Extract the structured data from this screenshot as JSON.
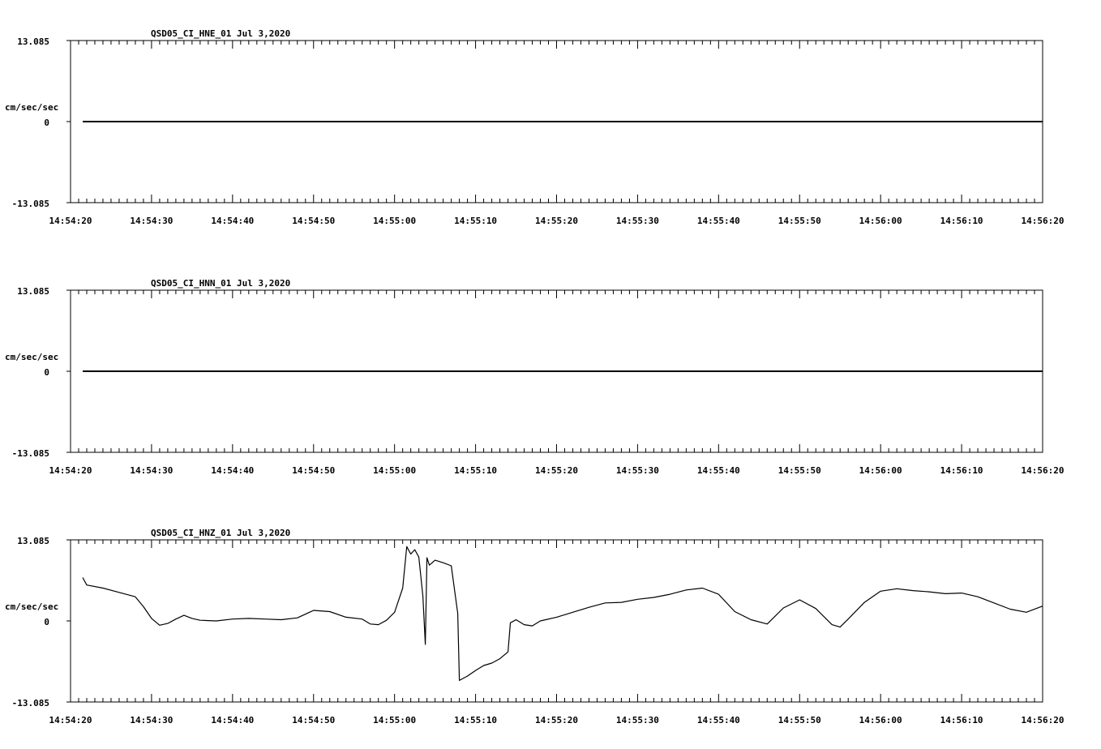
{
  "chart_data": [
    {
      "type": "line",
      "title": "QSD05_CI_HNE_01  Jul 3,2020",
      "ylabel": "cm/sec/sec",
      "ylim": [
        -13.085,
        13.085
      ],
      "ytick_labels": [
        "13.085",
        "0",
        "-13.085"
      ],
      "xlim": [
        "14:54:20",
        "14:56:20"
      ],
      "xtick_labels": [
        "14:54:20",
        "14:54:30",
        "14:54:40",
        "14:54:50",
        "14:55:00",
        "14:55:10",
        "14:55:20",
        "14:55:30",
        "14:55:40",
        "14:55:50",
        "14:56:00",
        "14:56:10",
        "14:56:20"
      ],
      "series": [
        {
          "x": [
            "14:54:21.5",
            "14:56:20"
          ],
          "y": [
            0,
            0
          ]
        }
      ]
    },
    {
      "type": "line",
      "title": "QSD05_CI_HNN_01  Jul 3,2020",
      "ylabel": "cm/sec/sec",
      "ylim": [
        -13.085,
        13.085
      ],
      "ytick_labels": [
        "13.085",
        "0",
        "-13.085"
      ],
      "xlim": [
        "14:54:20",
        "14:56:20"
      ],
      "xtick_labels": [
        "14:54:20",
        "14:54:30",
        "14:54:40",
        "14:54:50",
        "14:55:00",
        "14:55:10",
        "14:55:20",
        "14:55:30",
        "14:55:40",
        "14:55:50",
        "14:56:00",
        "14:56:10",
        "14:56:20"
      ],
      "series": [
        {
          "x": [
            "14:54:21.5",
            "14:56:20"
          ],
          "y": [
            0,
            0
          ]
        }
      ]
    },
    {
      "type": "line",
      "title": "QSD05_CI_HNZ_01  Jul 3,2020",
      "ylabel": "cm/sec/sec",
      "ylim": [
        -13.085,
        13.085
      ],
      "ytick_labels": [
        "13.085",
        "0",
        "-13.085"
      ],
      "xlim": [
        "14:54:20",
        "14:56:20"
      ],
      "xtick_labels": [
        "14:54:20",
        "14:54:30",
        "14:54:40",
        "14:54:50",
        "14:55:00",
        "14:55:10",
        "14:55:20",
        "14:55:30",
        "14:55:40",
        "14:55:50",
        "14:56:00",
        "14:56:10",
        "14:56:20"
      ],
      "series": [
        {
          "x": [
            "14:54:21.5",
            "14:54:22",
            "14:54:24",
            "14:54:26",
            "14:54:28",
            "14:54:29",
            "14:54:30",
            "14:54:31",
            "14:54:32",
            "14:54:33",
            "14:54:34",
            "14:54:35",
            "14:54:36",
            "14:54:38",
            "14:54:40",
            "14:54:42",
            "14:54:44",
            "14:54:46",
            "14:54:48",
            "14:54:50",
            "14:54:52",
            "14:54:54",
            "14:54:56",
            "14:54:57",
            "14:54:58",
            "14:54:59",
            "14:55:00",
            "14:55:01",
            "14:55:01.5",
            "14:55:02",
            "14:55:02.5",
            "14:55:03",
            "14:55:03.5",
            "14:55:03.8",
            "14:55:04",
            "14:55:04.3",
            "14:55:05",
            "14:55:06",
            "14:55:07",
            "14:55:07.8",
            "14:55:08",
            "14:55:09",
            "14:55:10",
            "14:55:11",
            "14:55:12",
            "14:55:13",
            "14:55:14",
            "14:55:14.3",
            "14:55:15",
            "14:55:16",
            "14:55:17",
            "14:55:18",
            "14:55:20",
            "14:55:22",
            "14:55:24",
            "14:55:26",
            "14:55:28",
            "14:55:30",
            "14:55:32",
            "14:55:34",
            "14:55:36",
            "14:55:38",
            "14:55:40",
            "14:55:42",
            "14:55:44",
            "14:55:46",
            "14:55:48",
            "14:55:50",
            "14:55:52",
            "14:55:54",
            "14:55:55",
            "14:55:56",
            "14:55:58",
            "14:56:00",
            "14:56:02",
            "14:56:04",
            "14:56:06",
            "14:56:08",
            "14:56:10",
            "14:56:12",
            "14:56:14",
            "14:56:16",
            "14:56:18",
            "14:56:20"
          ],
          "y": [
            7.0,
            5.8,
            5.3,
            4.6,
            3.9,
            2.3,
            0.4,
            -0.7,
            -0.4,
            0.3,
            0.9,
            0.4,
            0.1,
            0.0,
            0.3,
            0.4,
            0.3,
            0.2,
            0.5,
            1.7,
            1.5,
            0.6,
            0.3,
            -0.5,
            -0.6,
            0.1,
            1.4,
            5.3,
            12.0,
            10.8,
            11.5,
            10.3,
            4.0,
            -3.8,
            10.2,
            9.0,
            9.8,
            9.4,
            8.9,
            1.2,
            -9.6,
            -8.9,
            -8.0,
            -7.2,
            -6.8,
            -6.1,
            -5.0,
            -0.3,
            0.2,
            -0.6,
            -0.8,
            0.0,
            0.6,
            1.4,
            2.2,
            2.9,
            3.0,
            3.5,
            3.8,
            4.3,
            5.0,
            5.3,
            4.3,
            1.5,
            0.2,
            -0.5,
            2.1,
            3.4,
            2.0,
            -0.6,
            -1.0,
            0.3,
            3.0,
            4.8,
            5.2,
            4.9,
            4.7,
            4.4,
            4.5,
            3.9,
            2.9,
            1.9,
            1.4,
            2.4
          ]
        }
      ]
    }
  ]
}
